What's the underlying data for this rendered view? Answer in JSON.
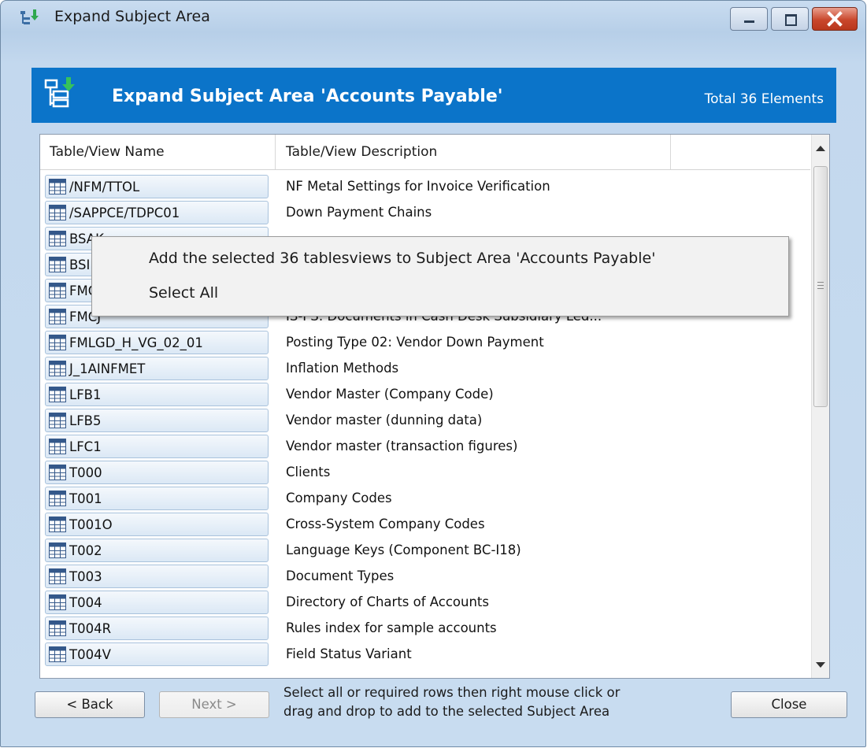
{
  "window": {
    "title": "Expand Subject Area",
    "controls": [
      "minimize-icon",
      "maximize-icon",
      "close-icon"
    ]
  },
  "header": {
    "title": "Expand Subject Area 'Accounts Payable'",
    "total": "Total 36 Elements",
    "background": "#0b74c9"
  },
  "grid": {
    "columns": [
      "Table/View Name",
      "Table/View Description"
    ],
    "rows": [
      {
        "name": "/NFM/TTOL",
        "description": "NF Metal Settings for Invoice Verification"
      },
      {
        "name": "/SAPPCE/TDPC01",
        "description": "Down Payment Chains"
      },
      {
        "name": "BSAK",
        "description": ""
      },
      {
        "name": "BSIK",
        "description": ""
      },
      {
        "name": "FMCI",
        "description": ""
      },
      {
        "name": "FMCJ",
        "description": "IS-PS: Documents in Cash Desk Subsidiary Led..."
      },
      {
        "name": "FMLGD_H_VG_02_01",
        "description": "Posting Type 02: Vendor Down Payment"
      },
      {
        "name": "J_1AINFMET",
        "description": "Inflation Methods"
      },
      {
        "name": "LFB1",
        "description": "Vendor Master (Company Code)"
      },
      {
        "name": "LFB5",
        "description": "Vendor master (dunning data)"
      },
      {
        "name": "LFC1",
        "description": "Vendor master (transaction figures)"
      },
      {
        "name": "T000",
        "description": "Clients"
      },
      {
        "name": "T001",
        "description": "Company Codes"
      },
      {
        "name": "T001O",
        "description": "Cross-System Company Codes"
      },
      {
        "name": "T002",
        "description": "Language Keys (Component BC-I18)"
      },
      {
        "name": "T003",
        "description": "Document Types"
      },
      {
        "name": "T004",
        "description": "Directory of Charts of Accounts"
      },
      {
        "name": "T004R",
        "description": "Rules index for sample accounts"
      },
      {
        "name": "T004V",
        "description": "Field Status Variant"
      }
    ],
    "row_icon": "table-icon"
  },
  "context_menu": {
    "items": [
      "Add the selected 36 tablesviews to Subject Area 'Accounts Payable'",
      "Select All"
    ]
  },
  "footer": {
    "back_label": "< Back",
    "next_label": "Next >",
    "hint_line1": "Select all or required rows then right mouse click or",
    "hint_line2": "drag and drop to add to the selected Subject Area",
    "close_label": "Close"
  }
}
